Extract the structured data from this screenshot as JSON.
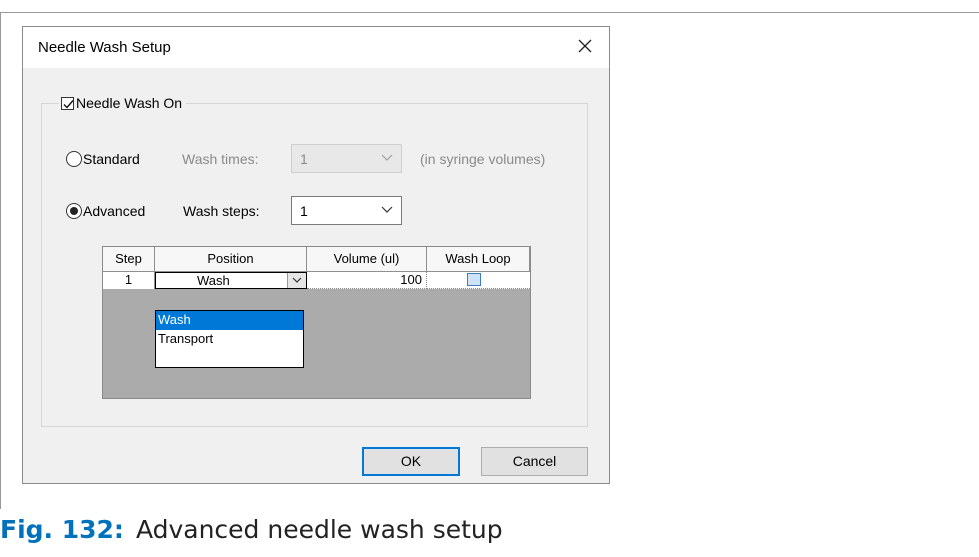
{
  "dialog": {
    "title": "Needle Wash Setup"
  },
  "needle_wash": {
    "label": "Needle Wash On",
    "checked": true
  },
  "standard": {
    "label": "Standard",
    "selected": false,
    "wash_times_label": "Wash times:",
    "wash_times_value": "1",
    "unit_note": "(in syringe volumes)"
  },
  "advanced": {
    "label": "Advanced",
    "selected": true,
    "wash_steps_label": "Wash steps:",
    "wash_steps_value": "1"
  },
  "table": {
    "columns": [
      "Step",
      "Position",
      "Volume (ul)",
      "Wash Loop"
    ],
    "rows": [
      {
        "step": "1",
        "position": "Wash",
        "volume": "100",
        "wash_loop": false
      }
    ],
    "position_options": [
      "Wash",
      "Transport"
    ],
    "position_selected": "Wash"
  },
  "buttons": {
    "ok": "OK",
    "cancel": "Cancel"
  },
  "caption": {
    "figure": "Fig. 132:",
    "text": "Advanced needle wash setup",
    "color": "#0072bc"
  },
  "colors": {
    "selection": "#0078d7",
    "dialog_bg": "#f0f0f0"
  }
}
